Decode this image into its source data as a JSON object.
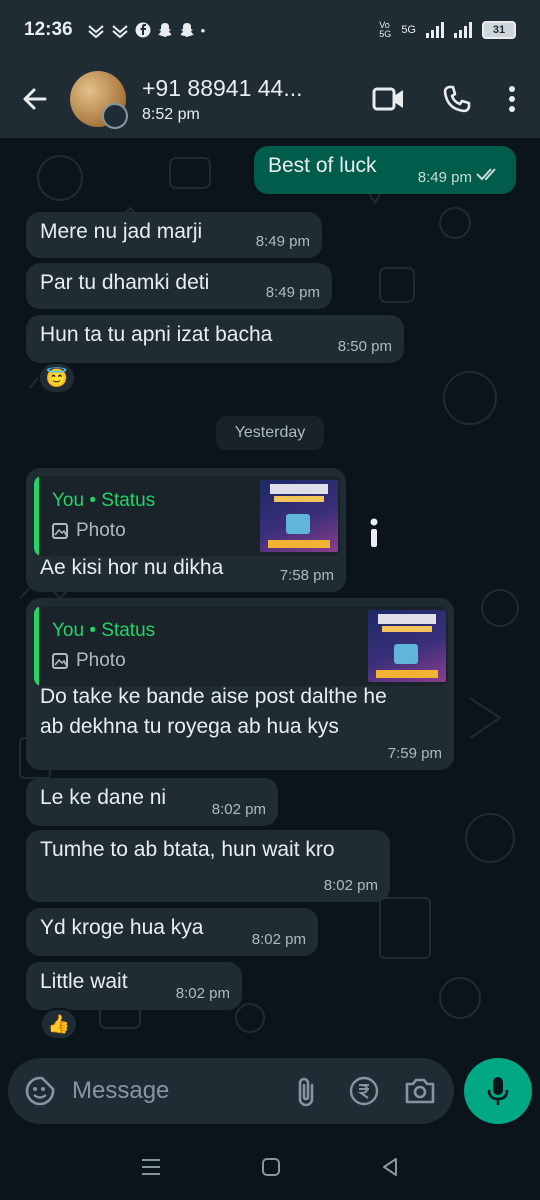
{
  "status_bar": {
    "time": "12:36",
    "network": "5G",
    "volte": "Vo\n5G",
    "battery": "31"
  },
  "header": {
    "name": "+91 88941 44...",
    "subtitle": "8:52 pm"
  },
  "messages": [
    {
      "text": "Best of luck",
      "time": "8:49 pm"
    },
    {
      "text": "Mere nu jad marji",
      "time": "8:49 pm"
    },
    {
      "text": "Par tu dhamki deti",
      "time": "8:49 pm"
    },
    {
      "text": "Hun ta tu apni izat bacha",
      "time": "8:50 pm"
    },
    {
      "text": "Ae kisi hor nu dikha",
      "time": "7:58 pm",
      "quote_author": "You • Status",
      "quote_type": "Photo"
    },
    {
      "text": "Do take ke bande aise post dalthe he\nab dekhna tu royega ab hua kys",
      "time": "7:59 pm",
      "quote_author": "You • Status",
      "quote_type": "Photo"
    },
    {
      "text": "Le ke dane ni",
      "time": "8:02 pm"
    },
    {
      "text": "Tumhe to ab btata, hun wait kro",
      "time": "8:02 pm"
    },
    {
      "text": "Yd kroge hua kya",
      "time": "8:02 pm"
    },
    {
      "text": "Little wait",
      "time": "8:02 pm"
    }
  ],
  "reactions": [
    "😇",
    "👍"
  ],
  "day_separator": "Yesterday",
  "input": {
    "placeholder": "Message"
  },
  "colors": {
    "accent": "#00a884",
    "outgoing": "#005c4b",
    "incoming": "#202c33",
    "quote_bar": "#25d366"
  }
}
